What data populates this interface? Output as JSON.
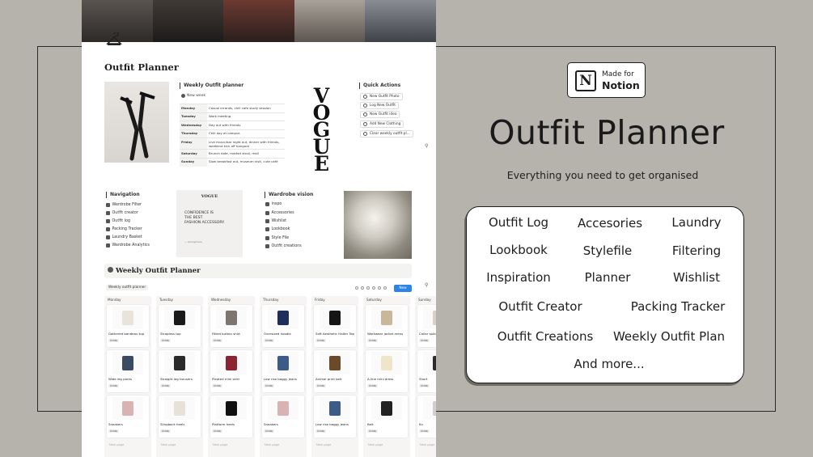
{
  "page": {
    "title": "Outfit Planner",
    "weekly": {
      "heading": "Weekly Outfit planner",
      "new_week_label": "New week",
      "rows": [
        {
          "day": "Monday",
          "plan": "Casual errands, chill cafe study session"
        },
        {
          "day": "Tuesday",
          "plan": "Work meeting"
        },
        {
          "day": "Wednesday",
          "plan": "Day out with friends"
        },
        {
          "day": "Thursday",
          "plan": "Chill day at campus"
        },
        {
          "day": "Friday",
          "plan": "Live music/bar night out, dinner with friends, weekend kick off hangout"
        },
        {
          "day": "Saturday",
          "plan": "Brunch date, market stroll, mall"
        },
        {
          "day": "Sunday",
          "plan": "Slow breakfast out, museum visit, cute café"
        }
      ]
    },
    "vogue_letters": [
      "V",
      "O",
      "G",
      "U",
      "E"
    ],
    "quick_actions": {
      "heading": "Quick Actions",
      "items": [
        "New Outfit Photo",
        "Log New Outfit",
        "New Outfit idea",
        "Add New Clothing",
        "Clear weekly outfit pl..."
      ]
    },
    "navigation": {
      "heading": "Navigation",
      "items": [
        "Wardrobe Filter",
        "Outfit creator",
        "Outfit log",
        "Packing Tracker",
        "Laundry Basket",
        "Wardrobe Analytics"
      ]
    },
    "quote": {
      "brand": "VOGUE",
      "lines": [
        "CONFIDENCE IS",
        "THE BEST",
        "FASHION ACCESSORY."
      ],
      "attribution": "— Anonymous"
    },
    "vision": {
      "heading": "Wardrobe vision",
      "items": [
        "inspo",
        "Accessories",
        "Wishlist",
        "Lookbook",
        "Style File",
        "Outfit creations"
      ]
    },
    "board": {
      "title": "Weekly Outfit Planner",
      "view_label": "Weekly outfit planner",
      "new_label": "New",
      "new_page_label": "New page",
      "columns": [
        {
          "day": "Monday",
          "cards": [
            {
              "name": "Gathered bandeau top",
              "tag": "Undo",
              "color": "#e8e4dc"
            },
            {
              "name": "Wide leg pants",
              "tag": "Undo",
              "color": "#3b4a63"
            },
            {
              "name": "Sneakers",
              "tag": "Undo",
              "color": "#d9b3b3"
            }
          ]
        },
        {
          "day": "Tuesday",
          "cards": [
            {
              "name": "Strapless top",
              "tag": "Undo",
              "color": "#1a1a1a"
            },
            {
              "name": "Straight leg trousers",
              "tag": "Undo",
              "color": "#2a2a2a"
            },
            {
              "name": "Slingback heels",
              "tag": "Undo",
              "color": "#e7e2d8"
            }
          ]
        },
        {
          "day": "Wednesday",
          "cards": [
            {
              "name": "Fitted button shirt",
              "tag": "Undo",
              "color": "#7d7670"
            },
            {
              "name": "Pleated mini skirt",
              "tag": "Undo",
              "color": "#8a2433"
            },
            {
              "name": "Platform heels",
              "tag": "Undo",
              "color": "#111111"
            }
          ]
        },
        {
          "day": "Thursday",
          "cards": [
            {
              "name": "Oversized hoodie",
              "tag": "Undo",
              "color": "#1f2d5a"
            },
            {
              "name": "Low rise baggy jeans",
              "tag": "Undo",
              "color": "#3d5b86"
            },
            {
              "name": "Sneakers",
              "tag": "Undo",
              "color": "#d9b3b3"
            }
          ]
        },
        {
          "day": "Friday",
          "cards": [
            {
              "name": "Soft Aesthetic Halter Top",
              "tag": "Undo",
              "color": "#151515"
            },
            {
              "name": "Animal print belt",
              "tag": "Undo",
              "color": "#6b4a2a"
            },
            {
              "name": "Low rise baggy jeans",
              "tag": "Undo",
              "color": "#3d5b86"
            }
          ]
        },
        {
          "day": "Saturday",
          "cards": [
            {
              "name": "Workwear jacket mens",
              "tag": "Undo",
              "color": "#c9b79c"
            },
            {
              "name": "A-line mini dress",
              "tag": "Undo",
              "color": "#efe6c9"
            },
            {
              "name": "Belt",
              "tag": "Undo",
              "color": "#222222"
            }
          ]
        },
        {
          "day": "Sunday",
          "cards": [
            {
              "name": "Collar splice",
              "tag": "Undo",
              "color": "#d8d0c4"
            },
            {
              "name": "Short",
              "tag": "Undo",
              "color": "#2b2b2b"
            },
            {
              "name": "Kn",
              "tag": "Undo",
              "color": "#cfcfcf"
            }
          ]
        }
      ]
    }
  },
  "right": {
    "badge": {
      "made_for": "Made for",
      "notion": "Notion",
      "logo": "N"
    },
    "title": "Outfit Planner",
    "subtitle": "Everything you need to get organised",
    "features": [
      "Outfit Log",
      "Accesories",
      "Laundry",
      "Lookbook",
      "Stylefile",
      "Filtering",
      "Inspiration",
      "Planner",
      "Wishlist",
      "Outfit Creator",
      "Packing Tracker",
      "Outfit Creations",
      "Weekly Outfit Plan",
      "And more..."
    ]
  },
  "colors": {
    "background": "#b6b3ac",
    "accent_blue": "#2e83e6",
    "ink": "#1e1e1e"
  }
}
